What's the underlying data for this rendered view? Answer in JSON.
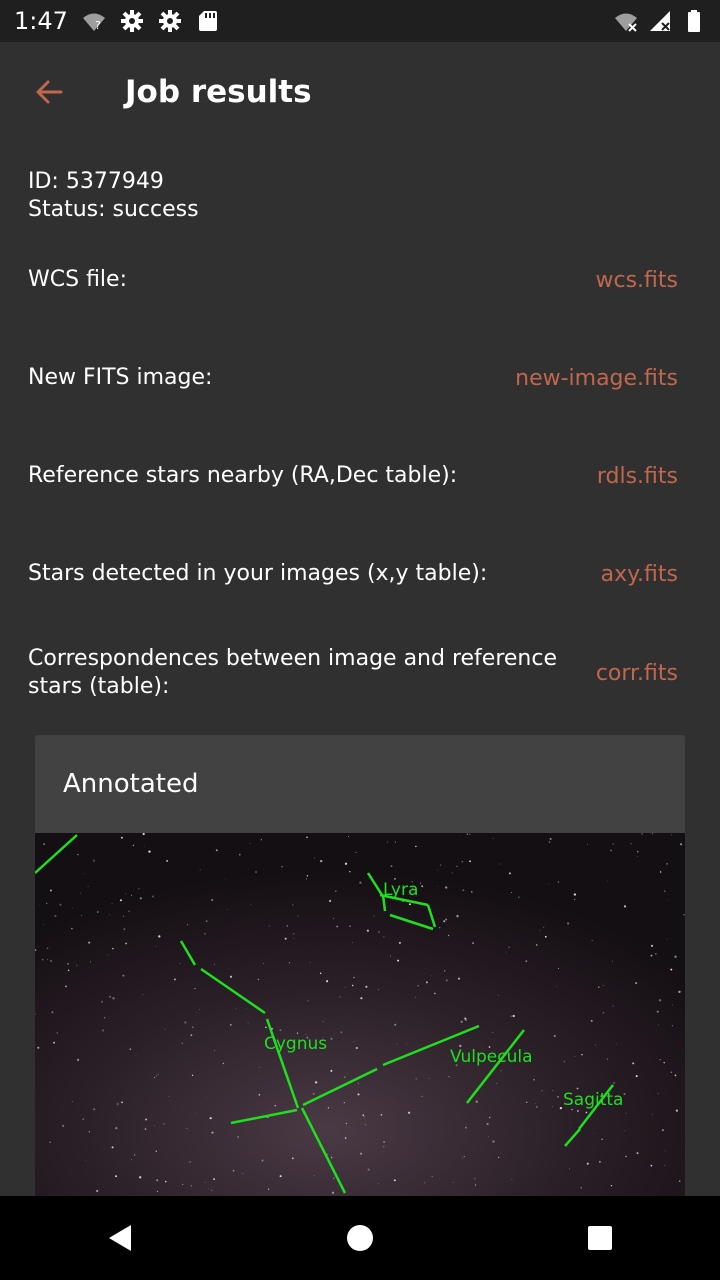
{
  "status_bar": {
    "time": "1:47",
    "icons": [
      "wifi-question-icon",
      "gear-icon",
      "gear-icon",
      "sd-card-icon",
      "wifi-off-icon",
      "signal-off-icon",
      "battery-icon"
    ]
  },
  "app_bar": {
    "title": "Job results",
    "back_icon": "arrow-left-icon"
  },
  "job": {
    "id_text": "ID: 5377949",
    "status_text": "Status: success"
  },
  "files": [
    {
      "label": "WCS file:",
      "link": "wcs.fits"
    },
    {
      "label": "New FITS image:",
      "link": "new-image.fits"
    },
    {
      "label": "Reference stars nearby (RA,Dec table):",
      "link": "rdls.fits"
    },
    {
      "label": "Stars detected in your images (x,y table):",
      "link": "axy.fits"
    },
    {
      "label": "Correspondences between image and reference stars (table):",
      "link": "corr.fits"
    }
  ],
  "annotated": {
    "title": "Annotated",
    "constellations": [
      "Lyra",
      "Cygnus",
      "Vulpecula",
      "Sagitta"
    ]
  },
  "colors": {
    "background": "#303030",
    "link": "#c0674d",
    "card": "#424242",
    "annotation": "#1fe01f"
  },
  "nav_bar": {
    "icons": [
      "back-triangle-icon",
      "home-circle-icon",
      "recents-square-icon"
    ]
  }
}
